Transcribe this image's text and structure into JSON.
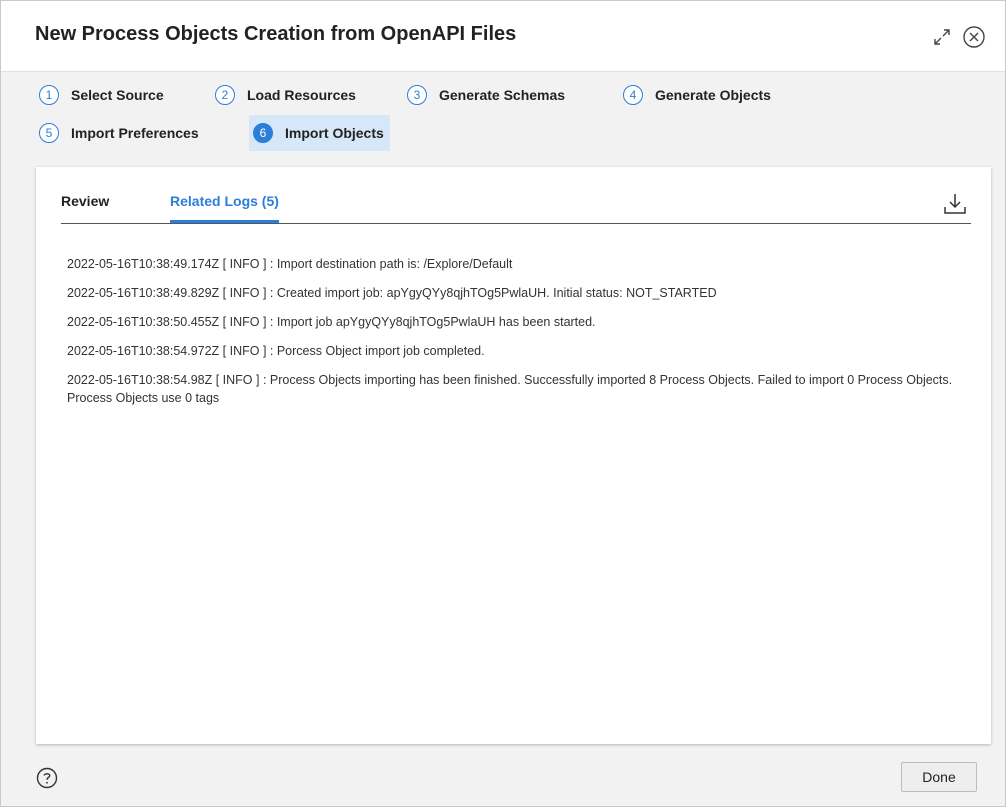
{
  "dialog": {
    "title": "New Process Objects Creation from OpenAPI Files"
  },
  "steps": [
    {
      "num": "1",
      "label": "Select Source"
    },
    {
      "num": "2",
      "label": "Load Resources"
    },
    {
      "num": "3",
      "label": "Generate Schemas"
    },
    {
      "num": "4",
      "label": "Generate Objects"
    },
    {
      "num": "5",
      "label": "Import Preferences"
    },
    {
      "num": "6",
      "label": "Import Objects",
      "active": true
    }
  ],
  "tabs": {
    "review": "Review",
    "related_logs": "Related Logs (5)",
    "active": "related_logs"
  },
  "logs": [
    "2022-05-16T10:38:49.174Z [ INFO ] : Import destination path is: /Explore/Default",
    "2022-05-16T10:38:49.829Z [ INFO ] : Created import job: apYgyQYy8qjhTOg5PwlaUH. Initial status: NOT_STARTED",
    "2022-05-16T10:38:50.455Z [ INFO ] : Import job apYgyQYy8qjhTOg5PwlaUH has been started.",
    "2022-05-16T10:38:54.972Z [ INFO ] : Porcess Object import job completed.",
    "2022-05-16T10:38:54.98Z [ INFO ] : Process Objects importing has been finished. Successfully imported 8 Process Objects. Failed to import 0 Process Objects. Process Objects use 0 tags"
  ],
  "footer": {
    "done_label": "Done"
  },
  "icons": {
    "expand": "expand-icon",
    "close": "close-icon",
    "download": "download-icon",
    "help": "help-icon"
  },
  "colors": {
    "accent": "#2b7fd8",
    "active_step_bg": "#d6e7f7"
  }
}
